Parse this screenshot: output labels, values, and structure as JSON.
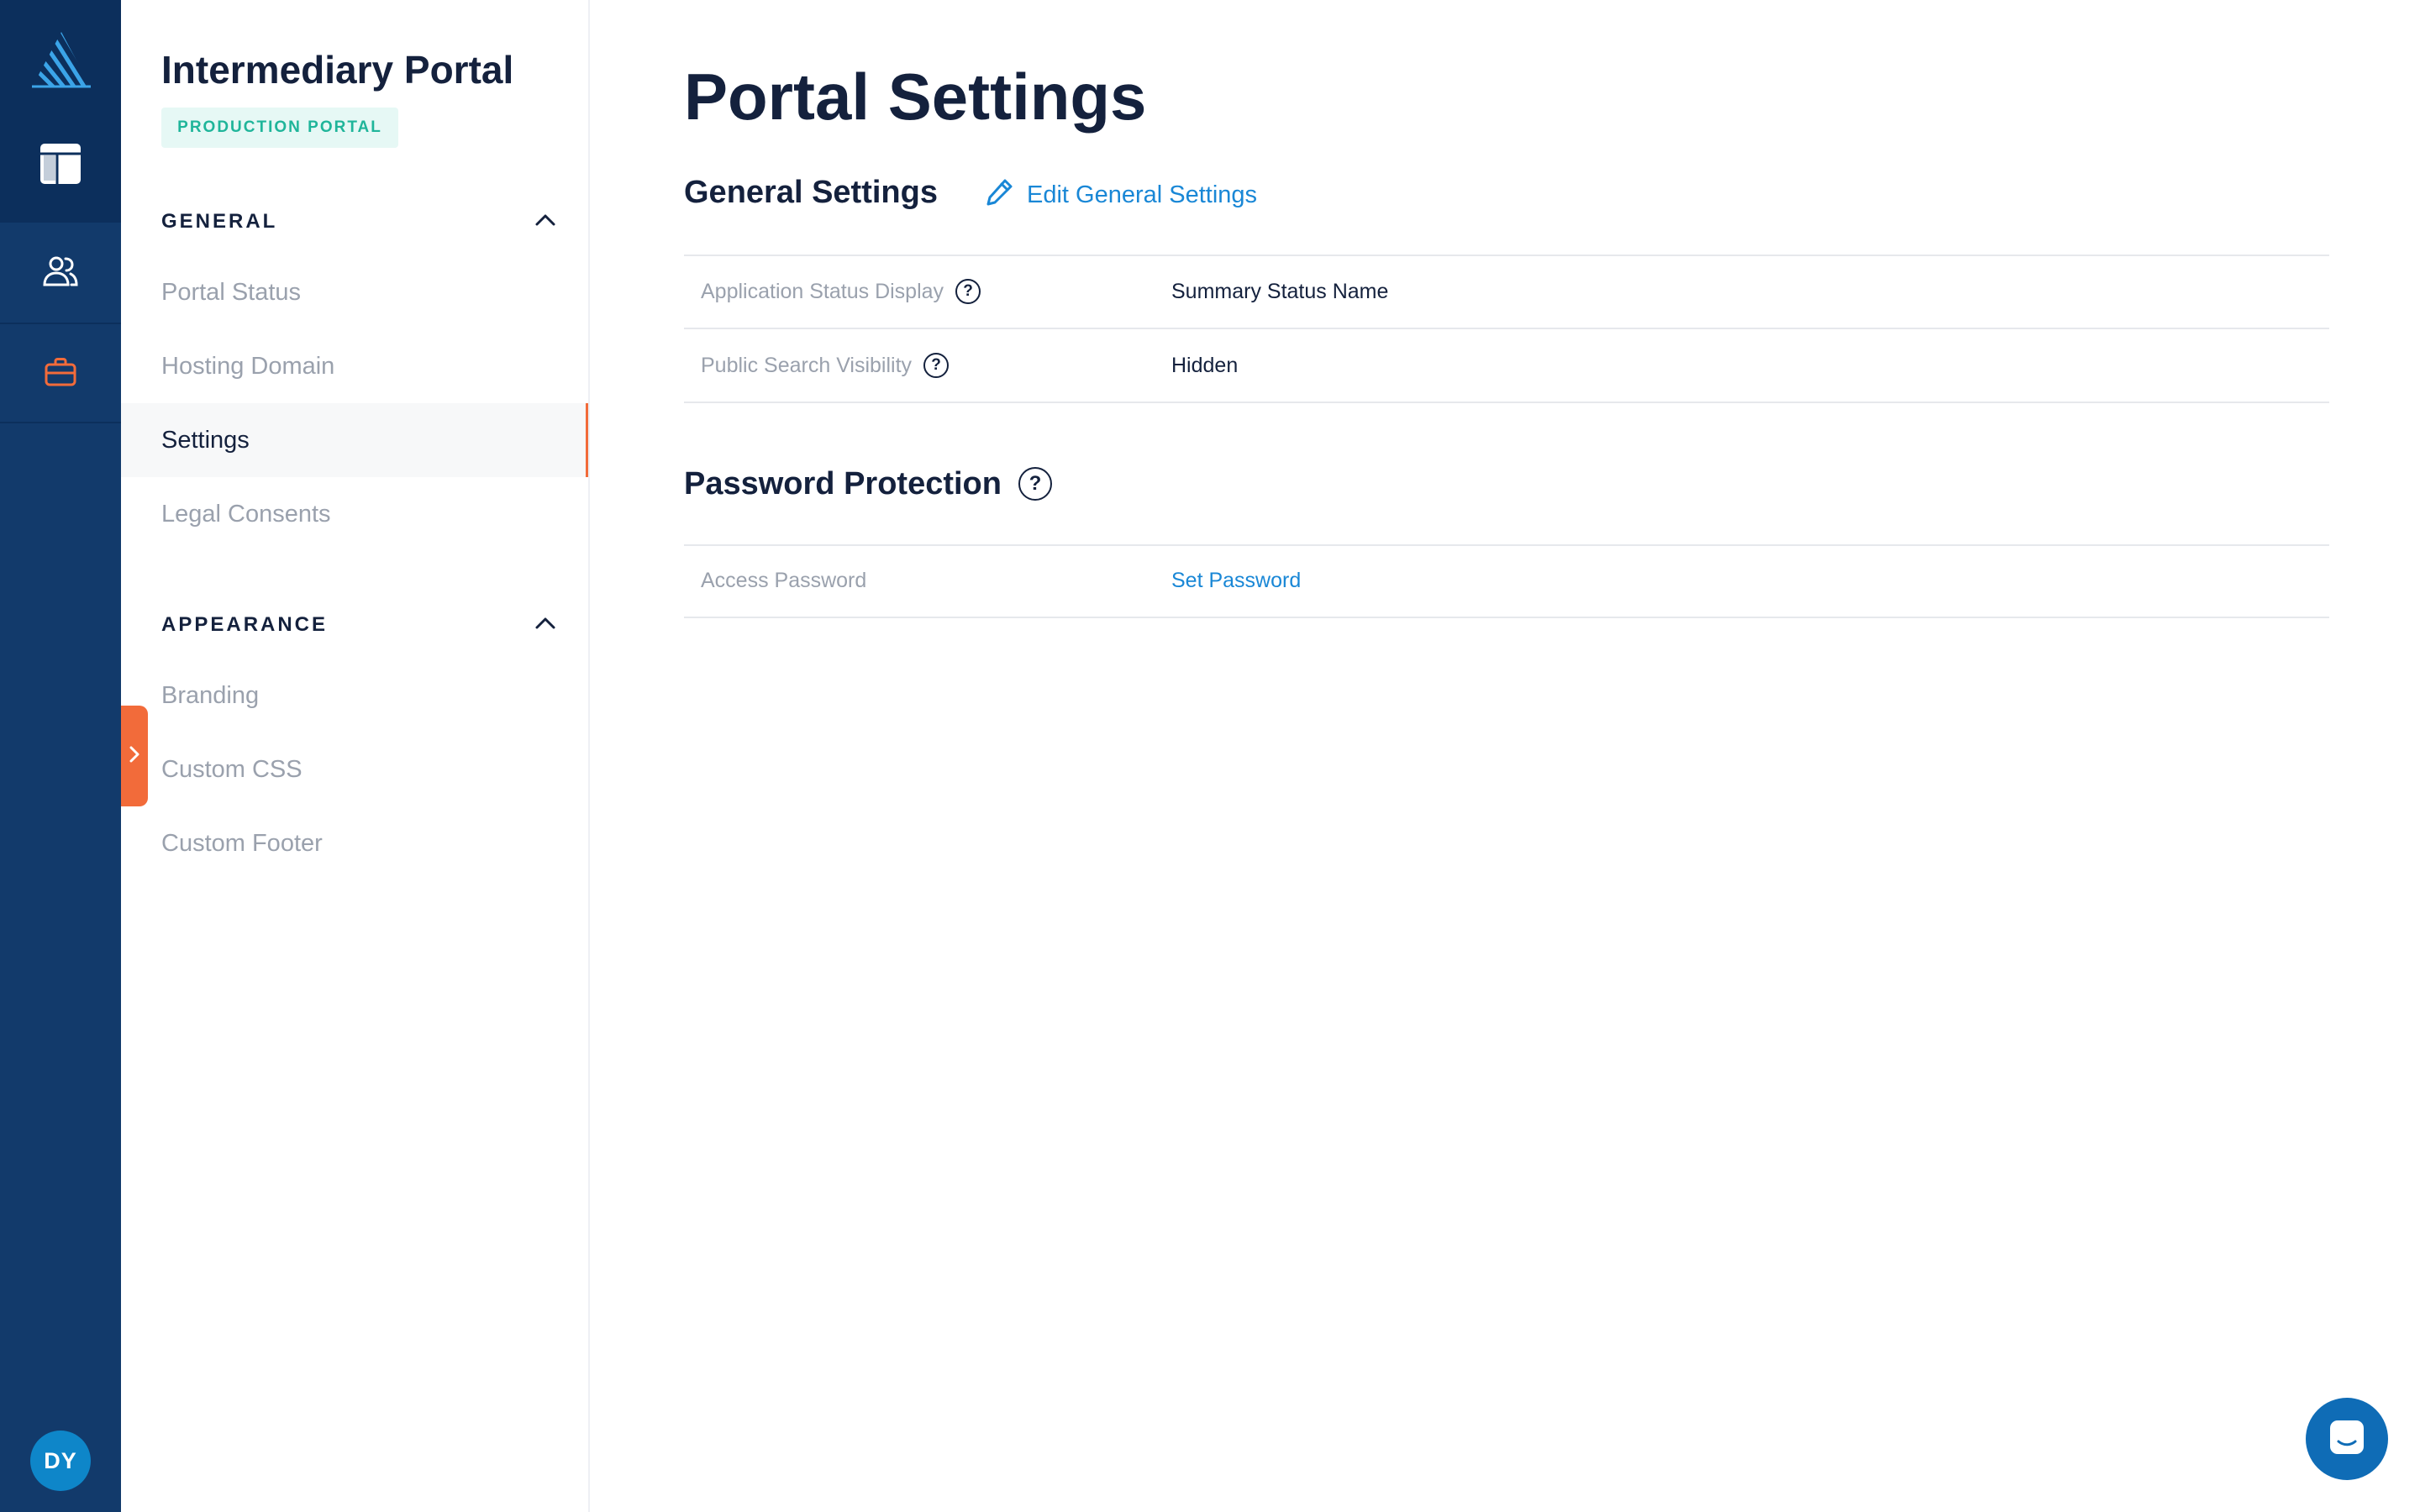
{
  "rail": {
    "avatar_initials": "DY",
    "icons": [
      "logo-icon",
      "layout-icon",
      "users-icon",
      "briefcase-icon"
    ],
    "colors": {
      "rail": "#123a6b",
      "rail_dark": "#0c2f5c",
      "accent": "#f26b3a",
      "avatar": "#0e86c9"
    }
  },
  "subnav": {
    "title": "Intermediary Portal",
    "badge": "PRODUCTION PORTAL",
    "sections": [
      {
        "label": "GENERAL",
        "items": [
          {
            "label": "Portal Status"
          },
          {
            "label": "Hosting Domain"
          },
          {
            "label": "Settings",
            "active": true
          },
          {
            "label": "Legal Consents"
          }
        ]
      },
      {
        "label": "APPEARANCE",
        "items": [
          {
            "label": "Branding"
          },
          {
            "label": "Custom CSS"
          },
          {
            "label": "Custom Footer"
          }
        ]
      }
    ]
  },
  "main": {
    "page_title": "Portal Settings",
    "general": {
      "heading": "General Settings",
      "edit_label": "Edit General Settings",
      "rows": [
        {
          "label": "Application Status Display",
          "value": "Summary Status Name"
        },
        {
          "label": "Public Search Visibility",
          "value": "Hidden"
        }
      ]
    },
    "password": {
      "heading": "Password Protection",
      "rows": [
        {
          "label": "Access Password",
          "value": "Set Password"
        }
      ]
    }
  },
  "colors": {
    "link": "#1987d6",
    "text": "#14213d",
    "muted": "#9aa1ad",
    "badge_text": "#1fb59a",
    "badge_bg": "#e6f8f5"
  }
}
